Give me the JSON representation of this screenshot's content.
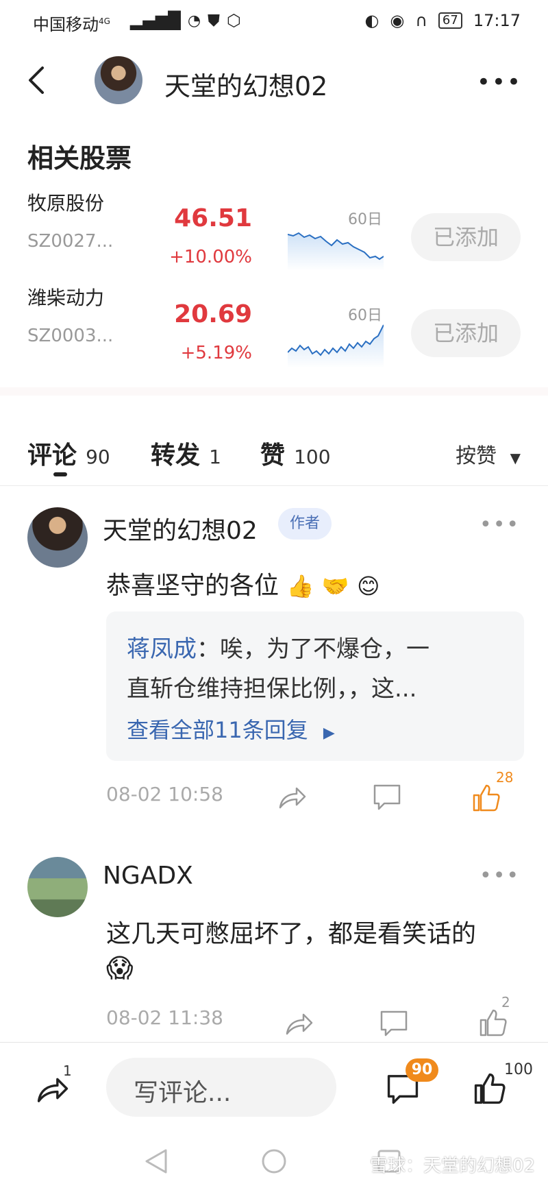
{
  "status_bar": {
    "carrier": "中国移动",
    "network": "4G",
    "battery": "67",
    "time": "17:17"
  },
  "header": {
    "title": "天堂的幻想02"
  },
  "related": {
    "title": "相关股票",
    "stocks": [
      {
        "name": "牧原股份",
        "code": "SZ0027...",
        "price": "46.51",
        "change": "+10.00%",
        "period": "60日",
        "button": "已添加"
      },
      {
        "name": "潍柴动力",
        "code": "SZ0003...",
        "price": "20.69",
        "change": "+5.19%",
        "period": "60日",
        "button": "已添加"
      }
    ]
  },
  "tabs": [
    {
      "label": "评论",
      "count": "90"
    },
    {
      "label": "转发",
      "count": "1"
    },
    {
      "label": "赞",
      "count": "100"
    }
  ],
  "sort": {
    "label": "按赞"
  },
  "comments": [
    {
      "user": "天堂的幻想02",
      "badge": "作者",
      "text": "恭喜坚守的各位",
      "reply": {
        "name": "蒋凤成",
        "line1": "：唉，为了不爆仓，一",
        "line2": "直斩仓维持担保比例，，这...",
        "link": "查看全部11条回复"
      },
      "time": "08-02 10:58",
      "likes": "28"
    },
    {
      "user": "NGADX",
      "text": "这几天可憋屈坏了，都是看笑话的",
      "time": "08-02 11:38",
      "likes": "2"
    }
  ],
  "bottom_bar": {
    "share_count": "1",
    "input_placeholder": "写评论...",
    "comment_badge": "90",
    "like_count": "100"
  },
  "watermark": "雪球：天堂的幻想02",
  "colors": {
    "price_up": "#e0393e",
    "link": "#3a67b0",
    "like_active": "#f08a1c",
    "badge": "#f08a1c"
  },
  "icons": [
    "back-icon",
    "more-icon",
    "share-icon",
    "comment-icon",
    "like-icon",
    "sort-down-icon",
    "nav-back-icon",
    "nav-home-icon",
    "nav-recent-icon"
  ]
}
